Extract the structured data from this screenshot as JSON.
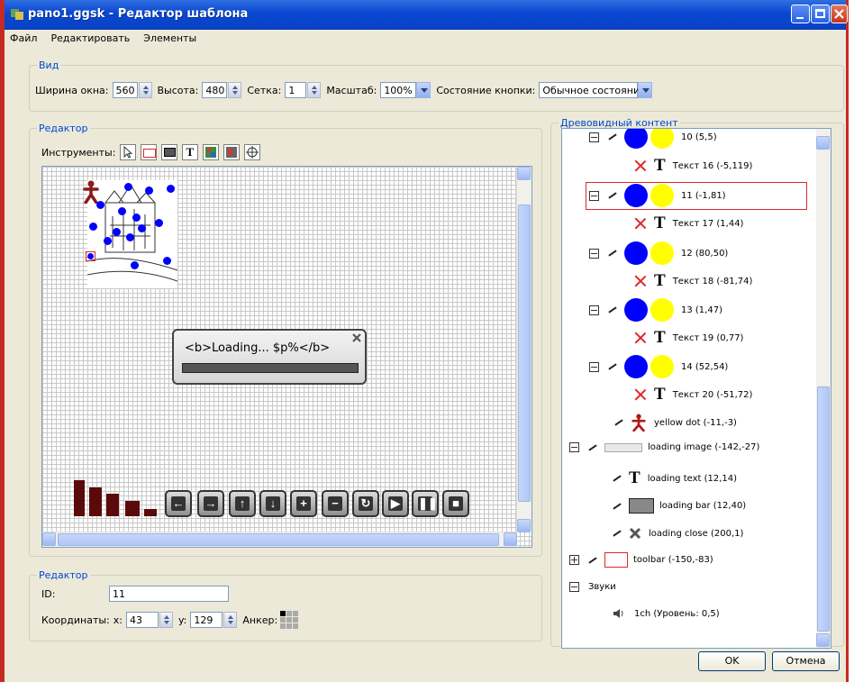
{
  "window": {
    "title": "pano1.ggsk - Редактор шаблона"
  },
  "menu": {
    "items": [
      "Файл",
      "Редактировать",
      "Элементы"
    ]
  },
  "view_group": {
    "legend": "Вид",
    "width_label": "Ширина окна:",
    "width_value": "560",
    "height_label": "Высота:",
    "height_value": "480",
    "grid_label": "Сетка:",
    "grid_value": "1",
    "scale_label": "Масштаб:",
    "scale_value": "100%",
    "button_state_label": "Состояние кнопки:",
    "button_state_value": "Обычное состояние"
  },
  "editor_group": {
    "legend": "Редактор",
    "tools_label": "Инструменты:",
    "loading_text": "<b>Loading... $p%</b>"
  },
  "props_group": {
    "legend": "Редактор",
    "id_label": "ID:",
    "id_value": "11",
    "coords_label": "Координаты:",
    "x_label": "x:",
    "x_value": "43",
    "y_label": "y:",
    "y_value": "129",
    "anchor_label": "Анкер:"
  },
  "tree": {
    "legend": "Древовидный контент",
    "nodes": [
      {
        "label": "10 (5,5)"
      },
      {
        "label": "Текст 16 (-5,119)"
      },
      {
        "label": "11 (-1,81)"
      },
      {
        "label": "Текст 17 (1,44)"
      },
      {
        "label": "12 (80,50)"
      },
      {
        "label": "Текст 18 (-81,74)"
      },
      {
        "label": "13 (1,47)"
      },
      {
        "label": "Текст 19 (0,77)"
      },
      {
        "label": "14 (52,54)"
      },
      {
        "label": "Текст 20 (-51,72)"
      },
      {
        "label": "yellow dot (-11,-3)"
      },
      {
        "label": "loading image (-142,-27)"
      },
      {
        "label": "loading text (12,14)"
      },
      {
        "label": "loading bar (12,40)"
      },
      {
        "label": "loading close (200,1)"
      },
      {
        "label": "toolbar (-150,-83)"
      },
      {
        "label": "Звуки"
      },
      {
        "label": "1ch (Уровень: 0,5)"
      }
    ]
  },
  "buttons": {
    "ok": "OK",
    "cancel": "Отмена"
  },
  "colors": {
    "title_bar": "#0a46d2",
    "window_border": "#c62b23",
    "blue_dot": "#0000ff",
    "yellow_dot": "#ffff00",
    "selection": "#e0262b"
  }
}
